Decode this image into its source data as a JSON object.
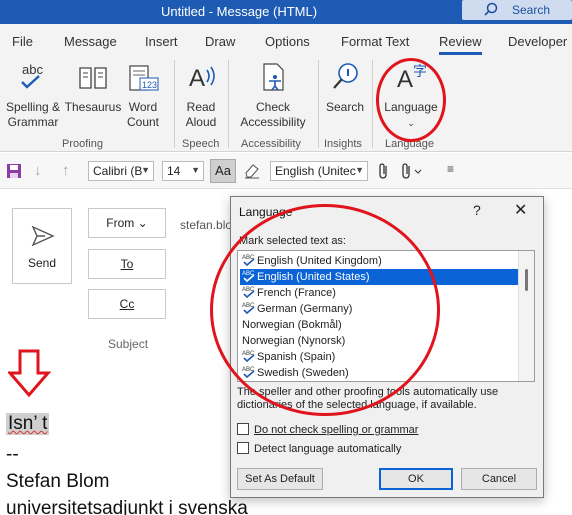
{
  "titlebar": {
    "title": "Untitled  -  Message (HTML)",
    "search": "Search"
  },
  "tabs": [
    "File",
    "Message",
    "Insert",
    "Draw",
    "Options",
    "Format Text",
    "Review",
    "Developer"
  ],
  "ribbon": {
    "spelling": "Spelling &\nGrammar",
    "thesaurus": "Thesaurus",
    "word_count": "Word\nCount",
    "read_aloud": "Read\nAloud",
    "check_accessibility": "Check\nAccessibility",
    "search": "Search",
    "language": "Language",
    "groups": {
      "proofing": "Proofing",
      "speech": "Speech",
      "accessibility": "Accessibility",
      "insights": "Insights",
      "language": "Language"
    }
  },
  "toolbar": {
    "font": "Calibri (B",
    "size": "14",
    "aa": "Aa",
    "language": "English (Unitec"
  },
  "compose": {
    "send": "Send",
    "from": "From",
    "to": "To",
    "cc": "Cc",
    "email": "stefan.blo",
    "subject": "Subject"
  },
  "body": {
    "isnt": "Isn’ t",
    "dashes": "--",
    "name": "Stefan Blom",
    "role": "universitetsadjunkt i svenska"
  },
  "dialog": {
    "title": "Language",
    "mark_label": "Mark selected text as:",
    "languages": [
      {
        "name": "English (United Kingdom)",
        "spell": true,
        "selected": false
      },
      {
        "name": "English (United States)",
        "spell": true,
        "selected": true
      },
      {
        "name": "French (France)",
        "spell": true,
        "selected": false
      },
      {
        "name": "German (Germany)",
        "spell": true,
        "selected": false
      },
      {
        "name": "Norwegian (Bokmål)",
        "spell": false,
        "selected": false
      },
      {
        "name": "Norwegian (Nynorsk)",
        "spell": false,
        "selected": false
      },
      {
        "name": "Spanish (Spain)",
        "spell": true,
        "selected": false
      },
      {
        "name": "Swedish (Sweden)",
        "spell": true,
        "selected": false
      }
    ],
    "info": "The speller and other proofing tools automatically use dictionaries of the selected language, if available.",
    "no_check": "Do not check spelling or grammar",
    "detect": "Detect language automatically",
    "set_default": "Set As Default",
    "ok": "OK",
    "cancel": "Cancel"
  },
  "colors": {
    "accent": "#1e5bb4",
    "annotation": "#e0141c",
    "selection": "#0a64d8"
  }
}
